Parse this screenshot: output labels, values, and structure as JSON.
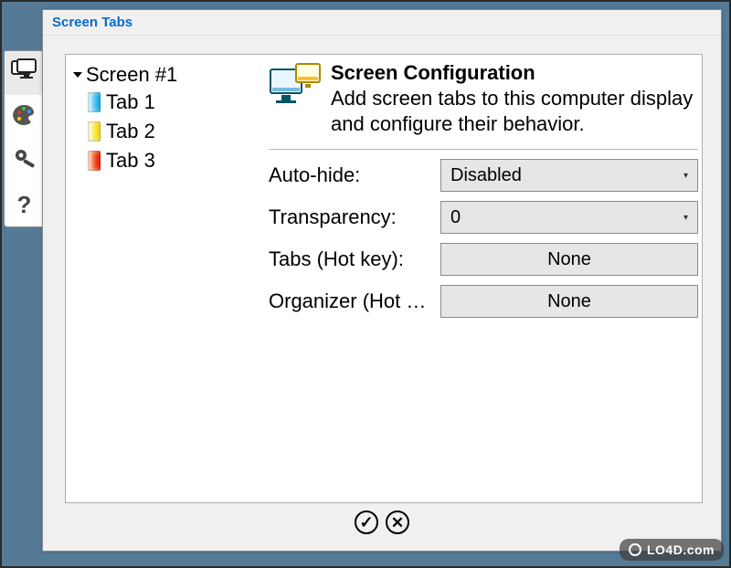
{
  "window": {
    "title": "Screen Tabs"
  },
  "side_toolbar": [
    {
      "name": "monitor-icon",
      "active": true
    },
    {
      "name": "palette-icon",
      "active": false
    },
    {
      "name": "settings-icon",
      "active": false
    },
    {
      "name": "help-icon",
      "active": false
    }
  ],
  "tree": {
    "root_label": "Screen #1",
    "expanded": true,
    "items": [
      {
        "label": "Tab 1",
        "color": "#1fb6ff"
      },
      {
        "label": "Tab 2",
        "color": "#ffe400"
      },
      {
        "label": "Tab 3",
        "color": "#ff3a00"
      }
    ]
  },
  "config": {
    "title": "Screen Configuration",
    "description": "Add screen tabs to this computer display and configure their behavior.",
    "rows": {
      "auto_hide": {
        "label": "Auto-hide:",
        "value": "Disabled",
        "kind": "combo"
      },
      "transparency": {
        "label": "Transparency:",
        "value": "0",
        "kind": "combo"
      },
      "tabs_hotkey": {
        "label": "Tabs (Hot key):",
        "value": "None",
        "kind": "button"
      },
      "organizer": {
        "label": "Organizer (Hot key):",
        "value": "None",
        "kind": "button"
      }
    }
  },
  "buttons": {
    "ok_symbol": "✓",
    "cancel_symbol": "✕"
  },
  "watermark": "LO4D.com"
}
